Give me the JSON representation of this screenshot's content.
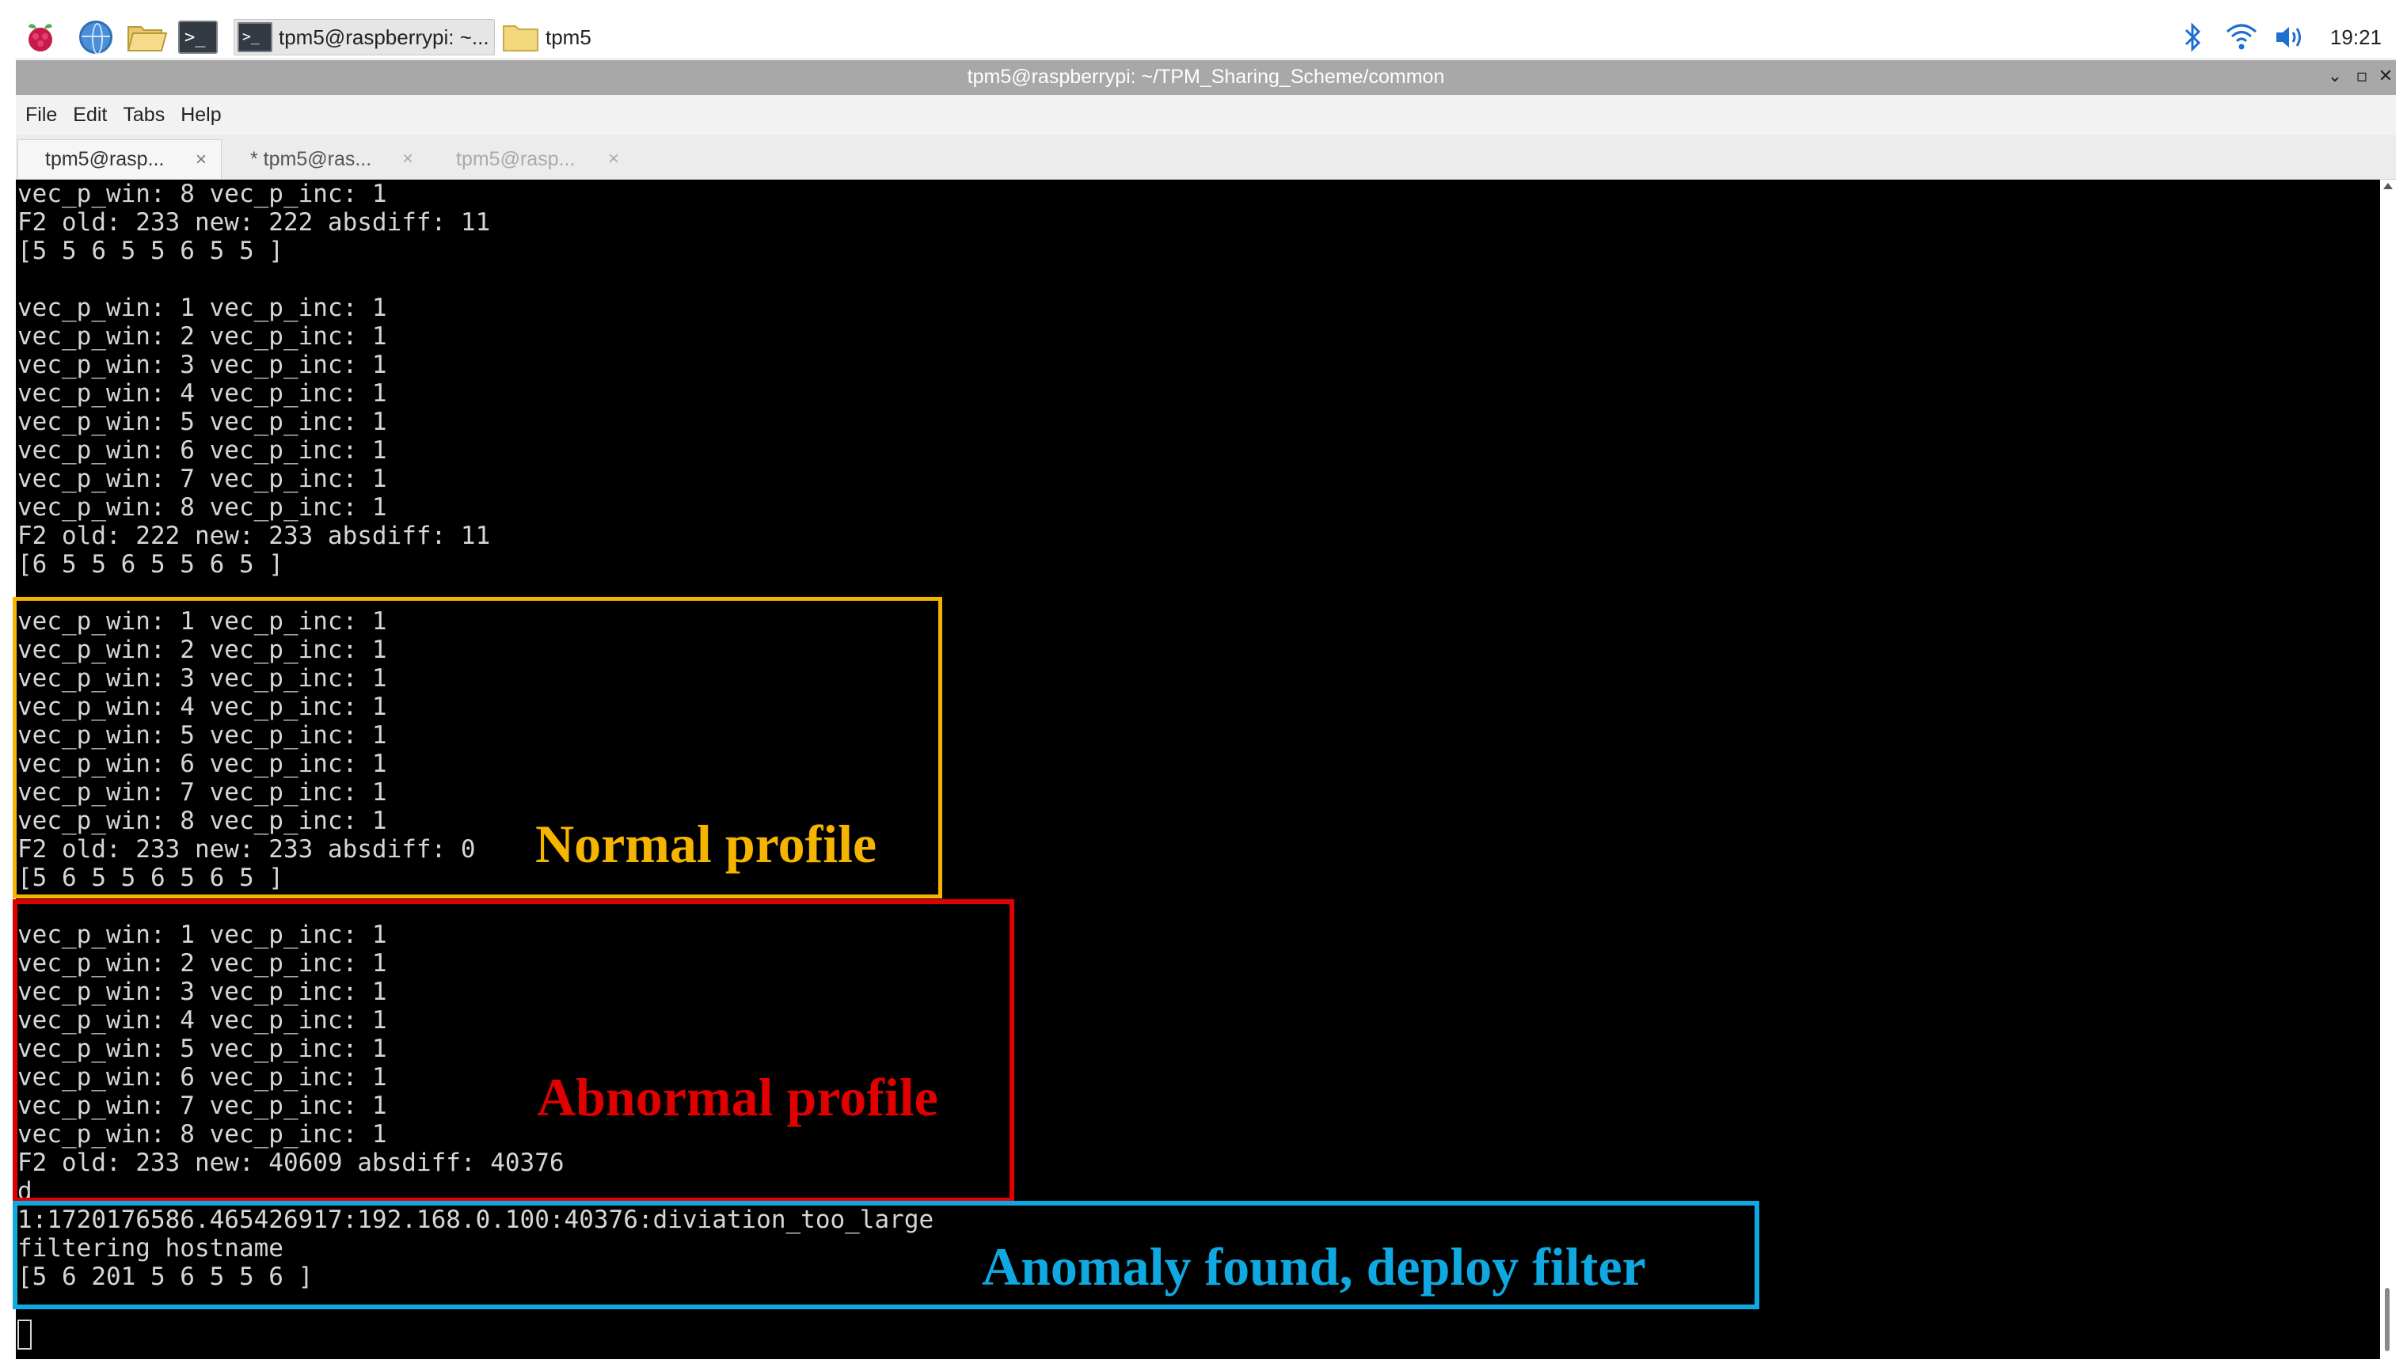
{
  "panel": {
    "icons": [
      "raspberry-menu-icon",
      "web-browser-icon",
      "file-manager-icon",
      "terminal-icon"
    ],
    "tasks": [
      {
        "label": "tpm5@raspberrypi: ~..."
      },
      {
        "label": "tpm5"
      }
    ],
    "tray_icons": [
      "bluetooth-icon",
      "wifi-icon",
      "volume-icon"
    ],
    "clock": "19:21"
  },
  "window": {
    "title": "tpm5@raspberrypi: ~/TPM_Sharing_Scheme/common",
    "menu": [
      "File",
      "Edit",
      "Tabs",
      "Help"
    ],
    "tabs": [
      {
        "label": "tpm5@rasp...",
        "active": true
      },
      {
        "label": "* tpm5@ras...",
        "active": false
      },
      {
        "label": "tpm5@rasp...",
        "active": false
      }
    ],
    "tab_close": "×"
  },
  "terminal": {
    "lines": [
      "vec_p_win: 8 vec_p_inc: 1",
      "F2 old: 233 new: 222 absdiff: 11",
      "[5 5 6 5 5 6 5 5 ]",
      "",
      "vec_p_win: 1 vec_p_inc: 1",
      "vec_p_win: 2 vec_p_inc: 1",
      "vec_p_win: 3 vec_p_inc: 1",
      "vec_p_win: 4 vec_p_inc: 1",
      "vec_p_win: 5 vec_p_inc: 1",
      "vec_p_win: 6 vec_p_inc: 1",
      "vec_p_win: 7 vec_p_inc: 1",
      "vec_p_win: 8 vec_p_inc: 1",
      "F2 old: 222 new: 233 absdiff: 11",
      "[6 5 5 6 5 5 6 5 ]",
      "",
      "vec_p_win: 1 vec_p_inc: 1",
      "vec_p_win: 2 vec_p_inc: 1",
      "vec_p_win: 3 vec_p_inc: 1",
      "vec_p_win: 4 vec_p_inc: 1",
      "vec_p_win: 5 vec_p_inc: 1",
      "vec_p_win: 6 vec_p_inc: 1",
      "vec_p_win: 7 vec_p_inc: 1",
      "vec_p_win: 8 vec_p_inc: 1",
      "F2 old: 233 new: 233 absdiff: 0",
      "[5 6 5 5 6 5 6 5 ]",
      "",
      "vec_p_win: 1 vec_p_inc: 1",
      "vec_p_win: 2 vec_p_inc: 1",
      "vec_p_win: 3 vec_p_inc: 1",
      "vec_p_win: 4 vec_p_inc: 1",
      "vec_p_win: 5 vec_p_inc: 1",
      "vec_p_win: 6 vec_p_inc: 1",
      "vec_p_win: 7 vec_p_inc: 1",
      "vec_p_win: 8 vec_p_inc: 1",
      "F2 old: 233 new: 40609 absdiff: 40376",
      "d",
      "1:1720176586.465426917:192.168.0.100:40376:diviation_too_large",
      "filtering hostname",
      "[5 6 201 5 6 5 5 6 ]"
    ]
  },
  "annotations": {
    "normal": {
      "label": "Normal profile",
      "color": "#f5b400"
    },
    "abnormal": {
      "label": "Abnormal profile",
      "color": "#e00000"
    },
    "anomaly": {
      "label": "Anomaly found, deploy filter",
      "color": "#10a8e0"
    }
  }
}
